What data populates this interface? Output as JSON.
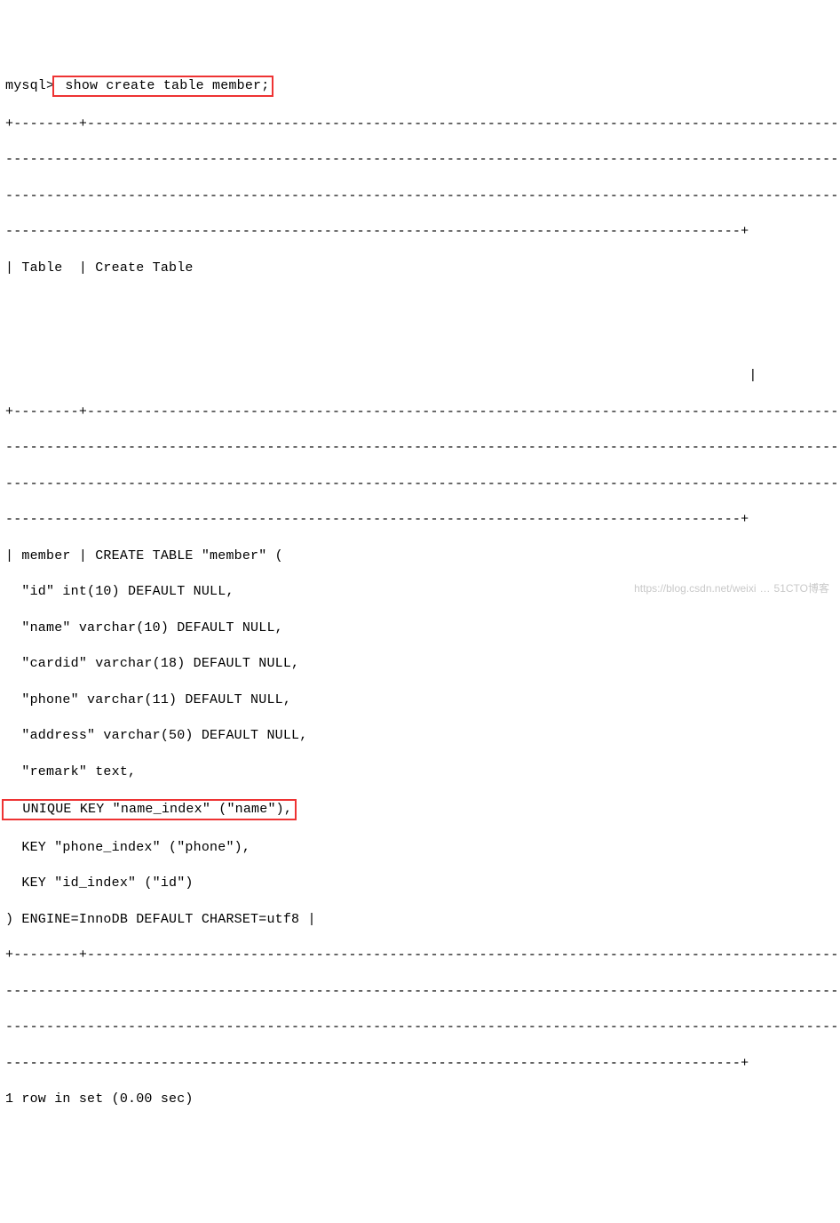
{
  "prompt": "mysql>",
  "command": " show create table member;",
  "sep_top": "+--------+-------------------------------------------------------------------------------------------------",
  "sep_mid": "-----------------------------------------------------------------------------------------------------------",
  "sep_end": "------------------------------------------------------------------------------------------+",
  "header": "| Table  | Create Table",
  "header_end_bar": "                                                                                           |",
  "body_line_open": "| member | CREATE TABLE \"member\" (",
  "col_id": "  \"id\" int(10) DEFAULT NULL,",
  "col_name": "  \"name\" varchar(10) DEFAULT NULL,",
  "col_cardid": "  \"cardid\" varchar(18) DEFAULT NULL,",
  "col_phone": "  \"phone\" varchar(11) DEFAULT NULL,",
  "col_address": "  \"address\" varchar(50) DEFAULT NULL,",
  "col_remark": "  \"remark\" text,",
  "key_unique": "  UNIQUE KEY \"name_index\" (\"name\"),",
  "key_phone": "  KEY \"phone_index\" (\"phone\"),",
  "key_id": "  KEY \"id_index\" (\"id\")",
  "engine": ") ENGINE=InnoDB DEFAULT CHARSET=utf8 |",
  "footer": "1 row in set (0.00 sec)",
  "watermark_left": "https://blog.csdn.net/weixi",
  "watermark_right": "51CTO博客"
}
